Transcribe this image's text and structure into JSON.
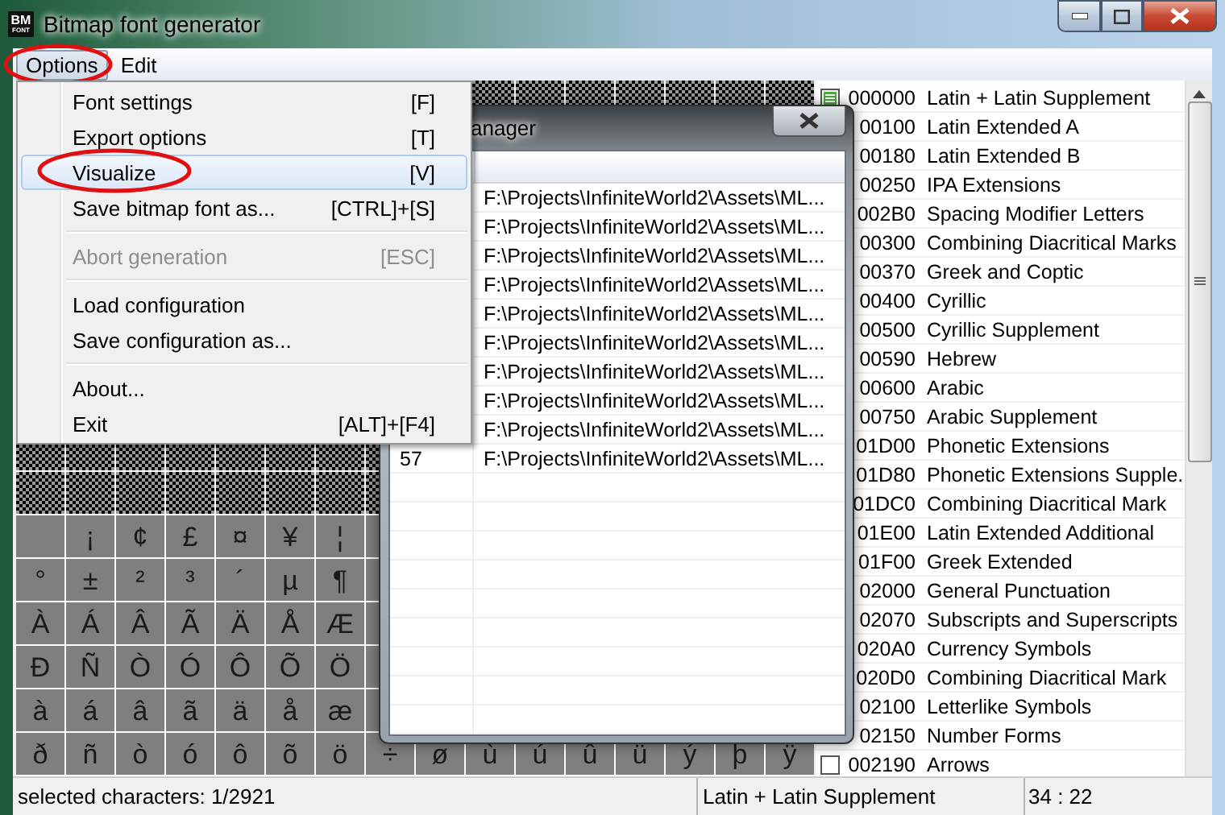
{
  "window": {
    "title": "Bitmap font generator",
    "logo": {
      "top": "BM",
      "bottom": "FONT"
    }
  },
  "menubar": [
    {
      "label": "Options",
      "selected": true,
      "circled": true
    },
    {
      "label": "Edit",
      "selected": false,
      "circled": false
    }
  ],
  "options_menu": [
    {
      "kind": "item",
      "label": "Font settings",
      "shortcut": "[F]",
      "highlighted": false,
      "disabled": false,
      "circled": false
    },
    {
      "kind": "item",
      "label": "Export options",
      "shortcut": "[T]",
      "highlighted": false,
      "disabled": false,
      "circled": false
    },
    {
      "kind": "item",
      "label": "Visualize",
      "shortcut": "[V]",
      "highlighted": true,
      "disabled": false,
      "circled": true
    },
    {
      "kind": "item",
      "label": "Save bitmap font as...",
      "shortcut": "[CTRL]+[S]",
      "highlighted": false,
      "disabled": false,
      "circled": false
    },
    {
      "kind": "separator"
    },
    {
      "kind": "item",
      "label": "Abort generation",
      "shortcut": "[ESC]",
      "highlighted": false,
      "disabled": true,
      "circled": false
    },
    {
      "kind": "separator"
    },
    {
      "kind": "item",
      "label": "Load configuration",
      "highlighted": false,
      "disabled": false,
      "circled": false
    },
    {
      "kind": "item",
      "label": "Save configuration as...",
      "highlighted": false,
      "disabled": false,
      "circled": false
    },
    {
      "kind": "separator"
    },
    {
      "kind": "item",
      "label": "About...",
      "highlighted": false,
      "disabled": false,
      "circled": false
    },
    {
      "kind": "item",
      "label": "Exit",
      "shortcut": "[ALT]+[F4]",
      "highlighted": false,
      "disabled": false,
      "circled": false
    }
  ],
  "char_grid": {
    "rows": [
      {
        "kind": "unused"
      },
      {
        "kind": "unused"
      },
      {
        "kind": "unused"
      },
      {
        "kind": "unused"
      },
      {
        "kind": "unused"
      },
      {
        "kind": "unused"
      },
      {
        "kind": "unused"
      },
      {
        "kind": "unused"
      },
      {
        "kind": "unused"
      },
      {
        "kind": "unused"
      },
      {
        "kind": "chars",
        "cells": [
          null,
          "¡",
          "¢",
          "£",
          "¤",
          "¥",
          "¦"
        ]
      },
      {
        "kind": "chars",
        "cells": [
          "°",
          "±",
          "²",
          "³",
          "´",
          "µ",
          "¶"
        ]
      },
      {
        "kind": "chars",
        "cells": [
          "À",
          "Á",
          "Â",
          "Ã",
          "Ä",
          "Å",
          "Æ"
        ]
      },
      {
        "kind": "chars",
        "cells": [
          "Ð",
          "Ñ",
          "Ò",
          "Ó",
          "Ô",
          "Õ",
          "Ö"
        ]
      },
      {
        "kind": "chars",
        "cells": [
          "à",
          "á",
          "â",
          "ã",
          "ä",
          "å",
          "æ"
        ]
      },
      {
        "kind": "chars",
        "cells": [
          "ð",
          "ñ",
          "ò",
          "ó",
          "ô",
          "õ",
          "ö",
          "÷",
          "ø",
          "ù",
          "ú",
          "û",
          "ü",
          "ý",
          "þ",
          "ÿ"
        ]
      }
    ]
  },
  "unicode_subsets": [
    {
      "code": "000000",
      "name": "Latin + Latin Supplement",
      "partial": true
    },
    {
      "code": "00100",
      "name": "Latin Extended A"
    },
    {
      "code": "00180",
      "name": "Latin Extended B"
    },
    {
      "code": "00250",
      "name": "IPA Extensions"
    },
    {
      "code": "002B0",
      "name": "Spacing Modifier Letters"
    },
    {
      "code": "00300",
      "name": "Combining Diacritical Marks"
    },
    {
      "code": "00370",
      "name": "Greek and Coptic"
    },
    {
      "code": "00400",
      "name": "Cyrillic"
    },
    {
      "code": "00500",
      "name": "Cyrillic Supplement"
    },
    {
      "code": "00590",
      "name": "Hebrew"
    },
    {
      "code": "00600",
      "name": "Arabic"
    },
    {
      "code": "00750",
      "name": "Arabic Supplement"
    },
    {
      "code": "01D00",
      "name": "Phonetic Extensions"
    },
    {
      "code": "01D80",
      "name": "Phonetic Extensions Supple."
    },
    {
      "code": "01DC0",
      "name": "Combining Diacritical Mark"
    },
    {
      "code": "01E00",
      "name": "Latin Extended Additional"
    },
    {
      "code": "01F00",
      "name": "Greek Extended"
    },
    {
      "code": "02000",
      "name": "General Punctuation"
    },
    {
      "code": "02070",
      "name": "Subscripts and Superscripts"
    },
    {
      "code": "020A0",
      "name": "Currency Symbols"
    },
    {
      "code": "020D0",
      "name": "Combining Diacritical Mark"
    },
    {
      "code": "02100",
      "name": "Letterlike Symbols"
    },
    {
      "code": "02150",
      "name": "Number Forms"
    },
    {
      "code": "002190",
      "name": "Arrows",
      "checked": false,
      "partial": false
    }
  ],
  "dialog": {
    "title": "anager",
    "rows": [
      {
        "path": "F:\\Projects\\InfiniteWorld2\\Assets\\ML..."
      },
      {
        "path": "F:\\Projects\\InfiniteWorld2\\Assets\\ML..."
      },
      {
        "path": "F:\\Projects\\InfiniteWorld2\\Assets\\ML..."
      },
      {
        "path": "F:\\Projects\\InfiniteWorld2\\Assets\\ML..."
      },
      {
        "path": "F:\\Projects\\InfiniteWorld2\\Assets\\ML..."
      },
      {
        "path": "F:\\Projects\\InfiniteWorld2\\Assets\\ML..."
      },
      {
        "path": "F:\\Projects\\InfiniteWorld2\\Assets\\ML..."
      },
      {
        "path": "F:\\Projects\\InfiniteWorld2\\Assets\\ML..."
      },
      {
        "path": "F:\\Projects\\InfiniteWorld2\\Assets\\ML..."
      },
      {
        "index": "57",
        "path": "F:\\Projects\\InfiniteWorld2\\Assets\\ML..."
      }
    ]
  },
  "status_bar": {
    "selection": "selected characters: 1/2921",
    "subset": "Latin + Latin Supplement",
    "position": "34 : 22"
  }
}
